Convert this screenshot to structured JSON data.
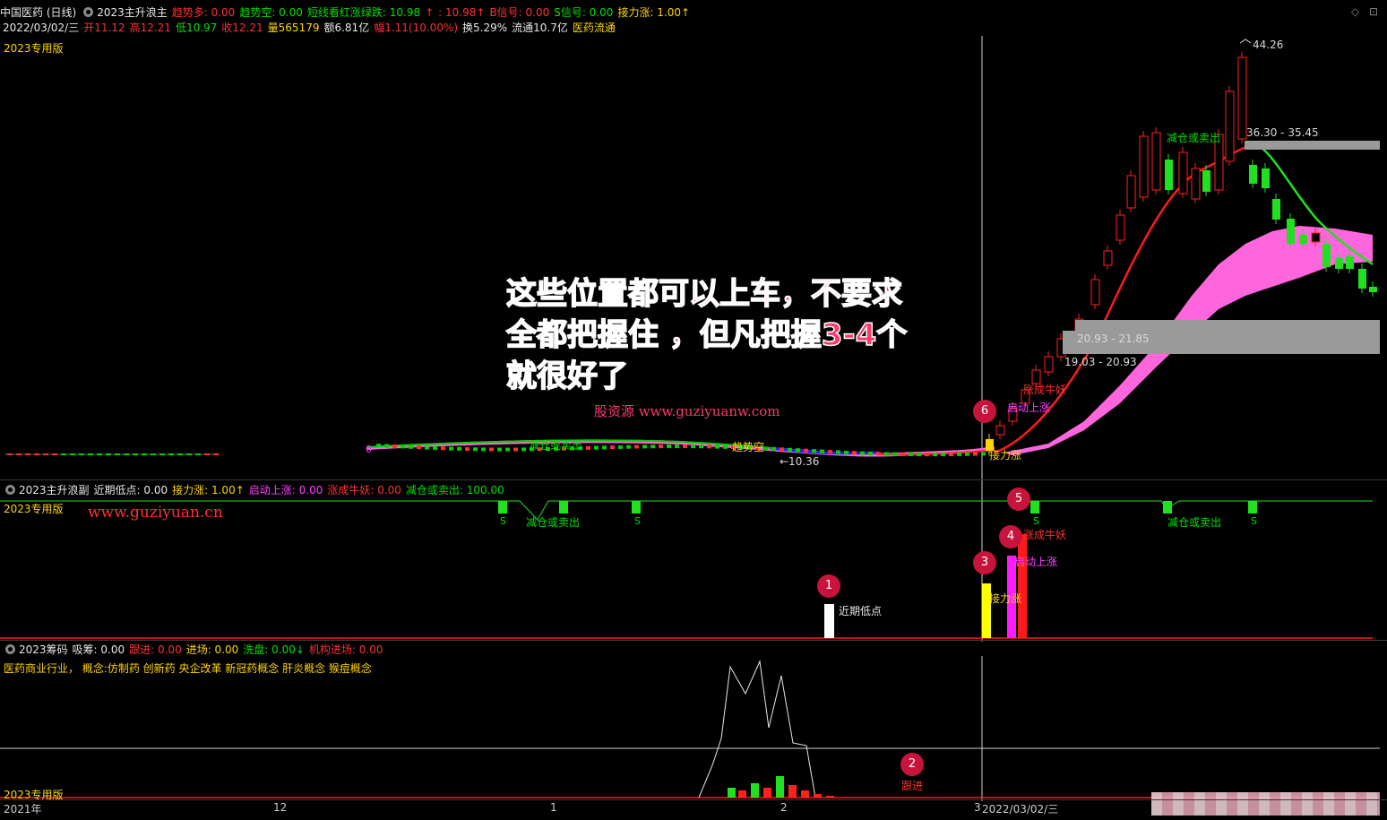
{
  "main": {
    "stock": "中国医药 (日线)",
    "indicator": "2023主升浪主",
    "fields": [
      {
        "text": "趋势多: 0.00",
        "color": "#ff3030"
      },
      {
        "text": "趋势空: 0.00",
        "color": "#00e000"
      },
      {
        "text": "短线看红涨绿跌: 10.98",
        "color": "#00e000"
      },
      {
        "text": "↑",
        "color": "#ff3030"
      },
      {
        "text": ": 10.98↑",
        "color": "#ff3030"
      },
      {
        "text": "B信号: 0.00",
        "color": "#ff3030"
      },
      {
        "text": "S信号: 0.00",
        "color": "#00e000"
      },
      {
        "text": "接力涨: 1.00↑",
        "color": "#ffd400"
      }
    ],
    "quote": [
      {
        "text": "2022/03/02/三",
        "color": "#e8e8e8"
      },
      {
        "text": "开11.12",
        "color": "#ff3030"
      },
      {
        "text": "高12.21",
        "color": "#ff3030"
      },
      {
        "text": "低10.97",
        "color": "#00e000"
      },
      {
        "text": "收12.21",
        "color": "#ff3030"
      },
      {
        "text": "量565179",
        "color": "#ffd400"
      },
      {
        "text": "额6.81亿",
        "color": "#e8e8e8"
      },
      {
        "text": "幅1.11(10.00%)",
        "color": "#ff3030"
      },
      {
        "text": "换5.29%",
        "color": "#e8e8e8"
      },
      {
        "text": "流通10.7亿",
        "color": "#e8e8e8"
      },
      {
        "text": "医药流通",
        "color": "#ffd400"
      }
    ],
    "edition": "2023专用版",
    "high_label": "44.26",
    "range1": "36.30 - 35.45",
    "range2": "20.93 - 21.85",
    "range3": "19.03 - 20.93",
    "low_label": "←10.36",
    "sig_jieli": "接力涨",
    "sig_qidong": "启动上涨",
    "sig_zhang": "涨成牛妖",
    "sig_jiancang": "减仓或卖出",
    "sig_qushi": "趋势空",
    "zero": "0"
  },
  "overlay": {
    "text": "这些位置都可以上车，不要求全都把握住 ，但凡把握3-4个就很好了",
    "watermark1": "股资源 www.guziyuanw.com",
    "watermark2": "www.guziyuan.cn"
  },
  "sub1": {
    "indicator": "2023主升浪副",
    "fields": [
      {
        "text": "近期低点: 0.00",
        "color": "#e8e8e8"
      },
      {
        "text": "接力涨: 1.00↑",
        "color": "#ffd400"
      },
      {
        "text": "启动上涨: 0.00",
        "color": "#ff40ff"
      },
      {
        "text": "涨成牛妖: 0.00",
        "color": "#ff3030"
      },
      {
        "text": "减仓或卖出: 100.00",
        "color": "#00e000"
      }
    ],
    "edition": "2023专用版",
    "lbl_jinqi": "近期低点",
    "lbl_jieli": "接力涨",
    "lbl_qidong": "启动上涨",
    "lbl_zhang": "涨成牛妖",
    "lbl_jiancang": "减仓或卖出",
    "lbl_s": "S"
  },
  "sub2": {
    "indicator": "2023筹码",
    "fields": [
      {
        "text": "吸筹: 0.00",
        "color": "#e8e8e8"
      },
      {
        "text": "跟进: 0.00",
        "color": "#ff3030"
      },
      {
        "text": "进场: 0.00",
        "color": "#ffd400"
      },
      {
        "text": "洗盘: 0.00↓",
        "color": "#00e000"
      },
      {
        "text": "机构进场: 0.00",
        "color": "#ff3030"
      }
    ],
    "concept": "医药商业行业， 概念:仿制药 创新药 央企改革 新冠药概念 肝炎概念 猴痘概念",
    "edition": "2023专用版",
    "lbl_genjin": "跟进"
  },
  "circles": [
    "1",
    "2",
    "3",
    "4",
    "5",
    "6"
  ],
  "axis": [
    "2021年",
    "12",
    "1",
    "2",
    "3",
    "2022/03/02/三"
  ]
}
